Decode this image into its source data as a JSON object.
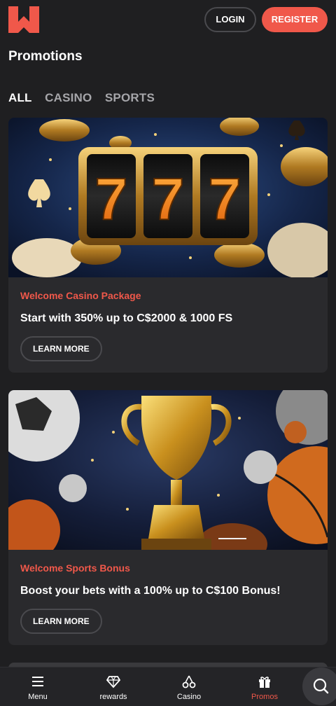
{
  "header": {
    "login_label": "LOGIN",
    "register_label": "REGISTER"
  },
  "page": {
    "title": "Promotions"
  },
  "tabs": [
    {
      "label": "ALL",
      "active": true
    },
    {
      "label": "CASINO",
      "active": false
    },
    {
      "label": "SPORTS",
      "active": false
    }
  ],
  "promos": [
    {
      "kicker": "Welcome Casino Package",
      "title": "Start with 350% up to C$2000 & 1000 FS",
      "button": "LEARN MORE",
      "image_text": "777"
    },
    {
      "kicker": "Welcome Sports Bonus",
      "title": "Boost your bets with a 100% up to C$100 Bonus!",
      "button": "LEARN MORE"
    }
  ],
  "nav": [
    {
      "label": "Menu",
      "icon": "hamburger-icon",
      "active": false
    },
    {
      "label": "rewards",
      "icon": "diamond-icon",
      "active": false
    },
    {
      "label": "Casino",
      "icon": "cherry-icon",
      "active": false
    },
    {
      "label": "Promos",
      "icon": "gift-icon",
      "active": true
    }
  ],
  "search_icon": "search-icon",
  "colors": {
    "background": "#1f1f21",
    "card": "#2a2a2d",
    "accent": "#f0584a",
    "muted_tab": "#a6a6aa"
  }
}
